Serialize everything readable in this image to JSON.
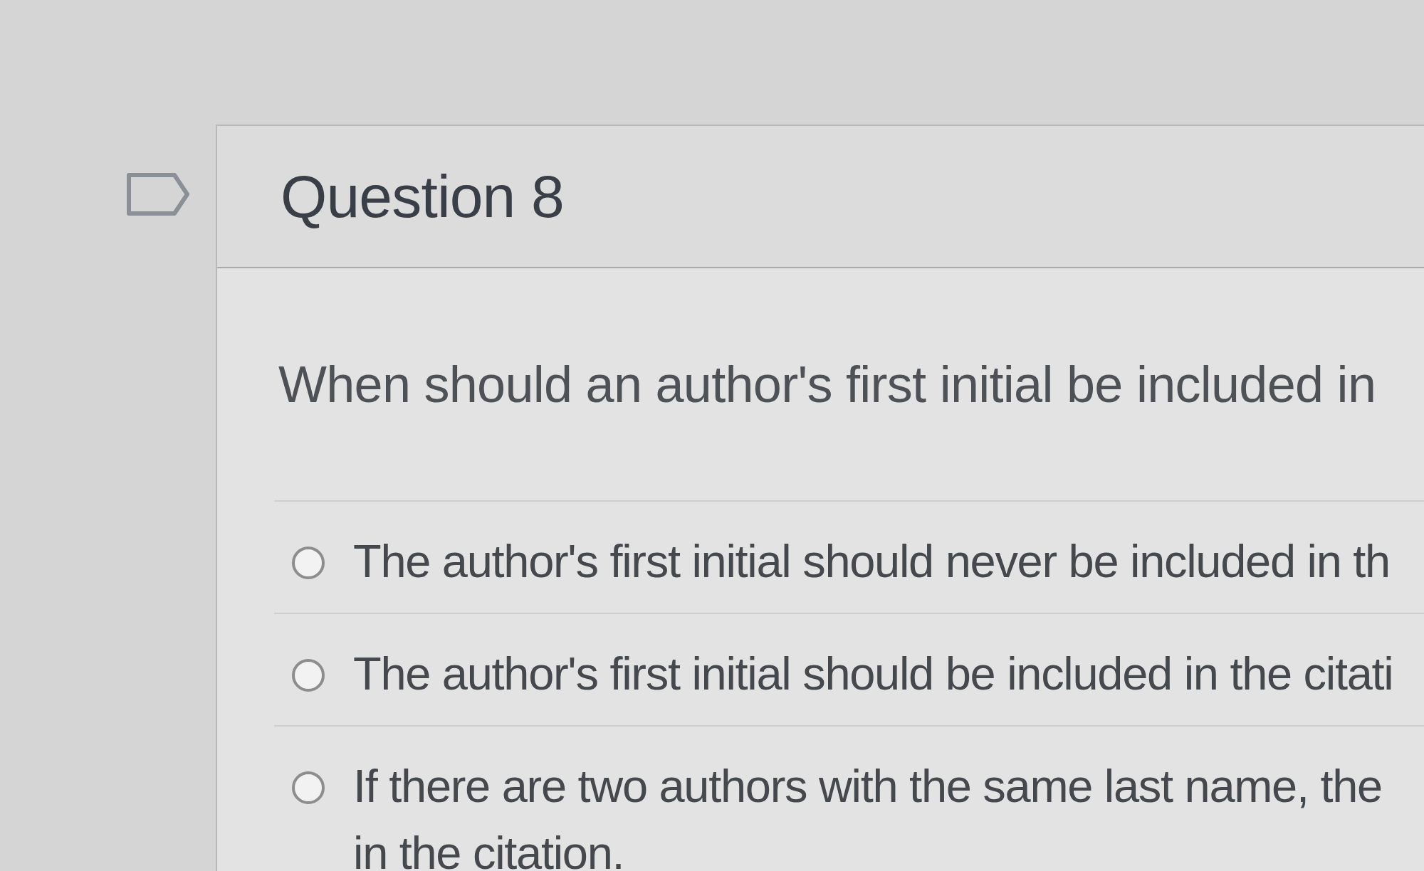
{
  "question": {
    "flagged": false,
    "title": "Question 8",
    "text": "When should an author's first initial be included in"
  },
  "options": [
    {
      "lines": [
        "The author's first initial should never be included in th"
      ],
      "selected": false
    },
    {
      "lines": [
        "The author's first initial should be included in the citati"
      ],
      "selected": false
    },
    {
      "lines": [
        "If there are two authors with the same last name, the",
        "in the citation."
      ],
      "selected": false
    }
  ]
}
